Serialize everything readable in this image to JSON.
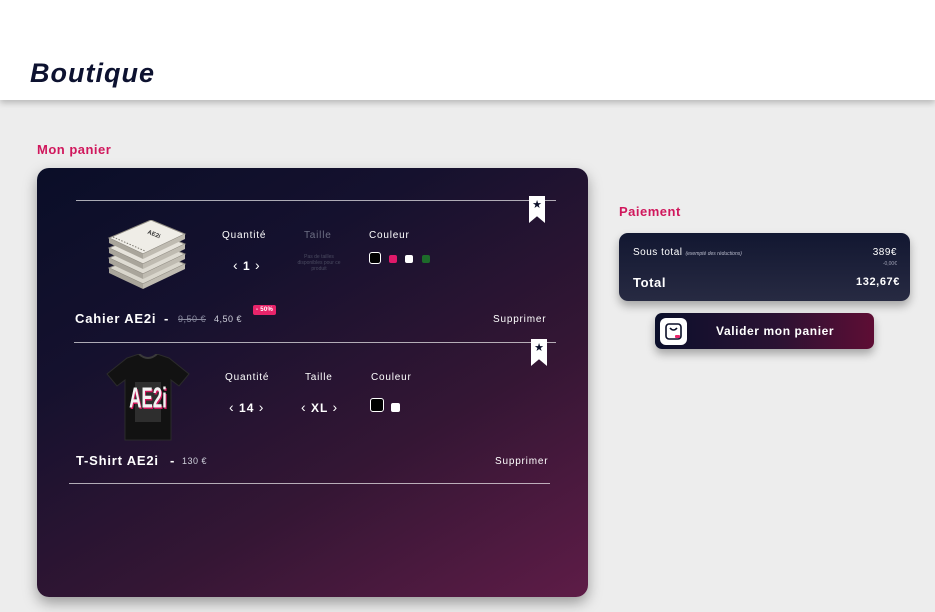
{
  "header": {
    "brand": "Boutique"
  },
  "cart": {
    "title": "Mon panier",
    "items": [
      {
        "name": "Cahier AE2i",
        "separator": "-",
        "old_price": "9,50 €",
        "price": "4,50 €",
        "discount_badge": "- 50%",
        "quantity_label": "Quantité",
        "quantity": "1",
        "size_label": "Taille",
        "size_note": "Pas de tailles disponibles pour ce produit",
        "color_label": "Couleur",
        "colors": [
          "#000000",
          "#e0196a",
          "#ffffff",
          "#1d6b2a"
        ],
        "remove_label": "Supprimer",
        "image": "notebook-stack",
        "image_text": "AE2i"
      },
      {
        "name": "T-Shirt AE2i",
        "separator": "-",
        "price": "130 €",
        "quantity_label": "Quantité",
        "quantity": "14",
        "size_label": "Taille",
        "size": "XL",
        "color_label": "Couleur",
        "colors": [
          "#000000",
          "#ffffff"
        ],
        "remove_label": "Supprimer",
        "image": "black-tshirt",
        "image_text": "AE2i"
      }
    ]
  },
  "payment": {
    "title": "Paiement",
    "subtotal_label": "Sous total",
    "subtotal_note": "(exempté des réductions)",
    "subtotal_value": "389€",
    "discount_value": "-0,00€",
    "total_label": "Total",
    "total_value": "132,67€",
    "validate_label": "Valider mon panier",
    "validate_icon": "shopping-bag-icon"
  },
  "icons": {
    "favorite": "star-bookmark-icon",
    "left": "‹",
    "right": "›"
  },
  "colors": {
    "accent": "#d0175c",
    "dark": "#0a0e28",
    "wine": "#5e1c47"
  }
}
